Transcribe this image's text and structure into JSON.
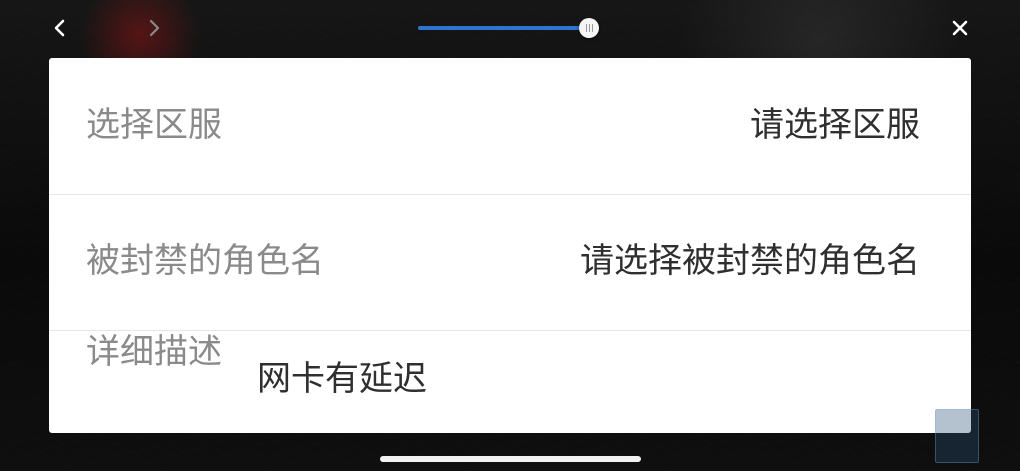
{
  "top_bar": {
    "back_icon": "chevron-left-icon",
    "forward_icon": "chevron-right-icon",
    "close_icon": "close-icon",
    "slider_progress": 0.95,
    "accent_color": "#2f74d0"
  },
  "form": {
    "server_label": "选择区服",
    "server_value": "请选择区服",
    "role_label": "被封禁的角色名",
    "role_value": "请选择被封禁的角色名",
    "desc_label": "详细描述",
    "desc_value": "网卡有延迟"
  }
}
